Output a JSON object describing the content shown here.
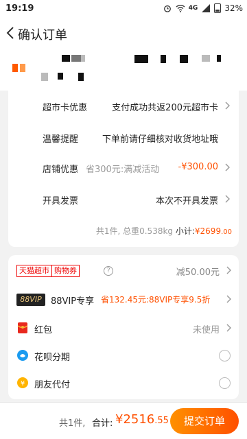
{
  "status_bar": {
    "time": "19:19",
    "network": "4G",
    "battery": "32%"
  },
  "nav": {
    "title": "确认订单"
  },
  "shop_section": {
    "rows": [
      {
        "label": "超市卡优惠",
        "value": "支付成功共返200元超市卡"
      },
      {
        "label": "温馨提醒",
        "value": "下单前请仔细核对收货地址哦"
      },
      {
        "label": "店铺优惠",
        "hint": "省300元:满减活动",
        "value": "-¥300.00"
      },
      {
        "label": "开具发票",
        "value": "本次不开具发票"
      }
    ],
    "summary": {
      "count": "共1件,",
      "weight": "总重0.538kg",
      "subtotal_label": "小计:",
      "subtotal_int": "¥2699",
      "subtotal_dec": ".00"
    }
  },
  "platform_section": {
    "tmall_coupon": {
      "tag_a": "天猫超市",
      "tag_b": "购物券",
      "help": "?",
      "value": "减50.00元"
    },
    "vip": {
      "badge": "88VIP",
      "label": "88VIP专享",
      "value": "省132.45元:88VIP专享9.5折"
    },
    "red_packet": {
      "label": "红包",
      "value": "未使用"
    },
    "huabei": {
      "label": "花呗分期"
    },
    "friend_pay": {
      "label": "朋友代付"
    }
  },
  "bottom_bar": {
    "count": "共1件,",
    "total_label": "合计:",
    "total_int": "¥2516",
    "total_dec": ".55",
    "submit": "提交订单"
  },
  "colors": {
    "accent": "#ff5000",
    "tmall_red": "#e00000",
    "vip_gold": "#e8c37a"
  },
  "icons": [
    "back-arrow-icon",
    "alarm-icon",
    "wifi-icon",
    "signal-icon",
    "battery-icon",
    "chevron-right-icon",
    "help-icon",
    "red-packet-icon",
    "huabei-icon",
    "friend-pay-icon"
  ]
}
